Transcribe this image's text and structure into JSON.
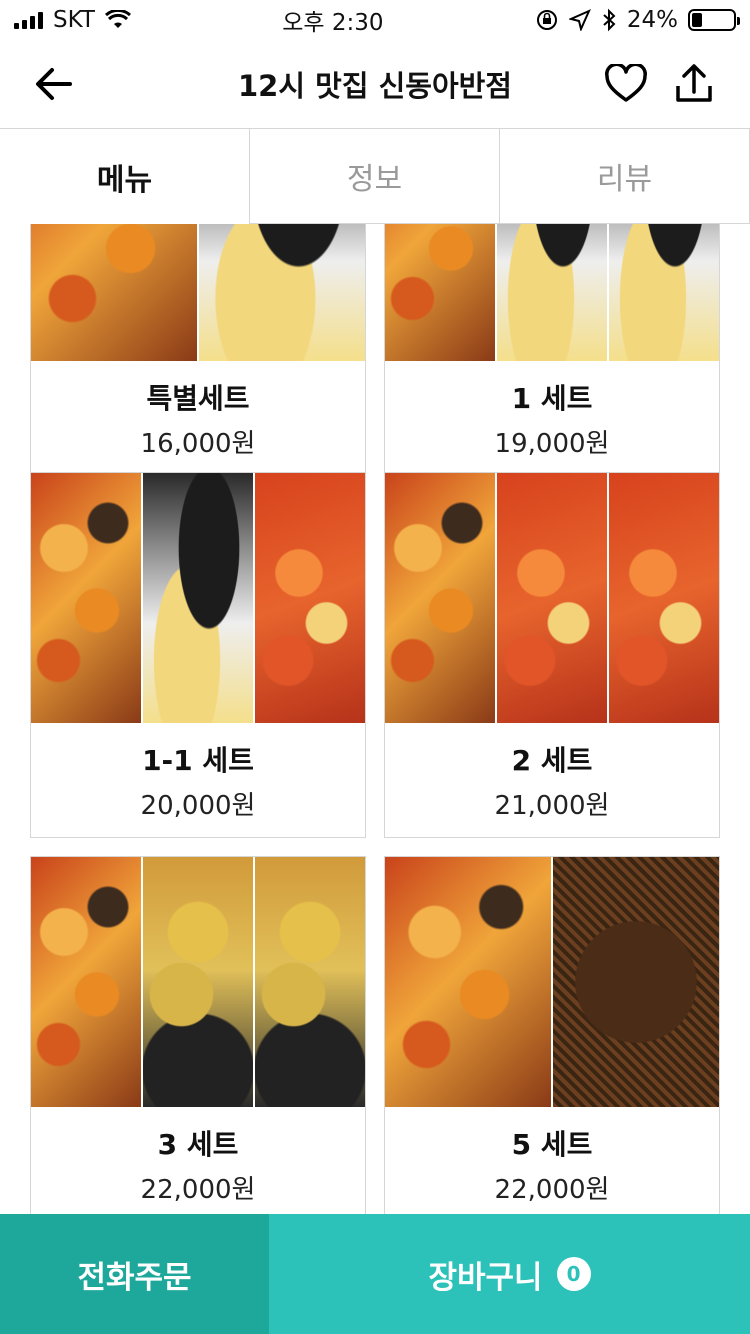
{
  "status_bar": {
    "carrier": "SKT",
    "time": "오후 2:30",
    "battery_percent": "24%",
    "battery_level": 0.24
  },
  "header": {
    "title": "12시 맛집 신동아반점",
    "icons": [
      "back-arrow-icon",
      "heart-icon",
      "share-icon"
    ]
  },
  "tabs": [
    {
      "label": "메뉴",
      "active": true
    },
    {
      "label": "정보",
      "active": false
    },
    {
      "label": "리뷰",
      "active": false
    }
  ],
  "menu_items": [
    {
      "name": "특별세트",
      "price": "16,000원"
    },
    {
      "name": "1 세트",
      "price": "19,000원"
    },
    {
      "name": "1-1 세트",
      "price": "20,000원"
    },
    {
      "name": "2 세트",
      "price": "21,000원"
    },
    {
      "name": "3 세트",
      "price": "22,000원"
    },
    {
      "name": "5 세트",
      "price": "22,000원"
    }
  ],
  "bottom_bar": {
    "phone_order_label": "전화주문",
    "cart_label": "장바구니",
    "cart_count": "0"
  },
  "colors": {
    "phone_button": "#1ea79b",
    "cart_button": "#2cc1b9"
  }
}
